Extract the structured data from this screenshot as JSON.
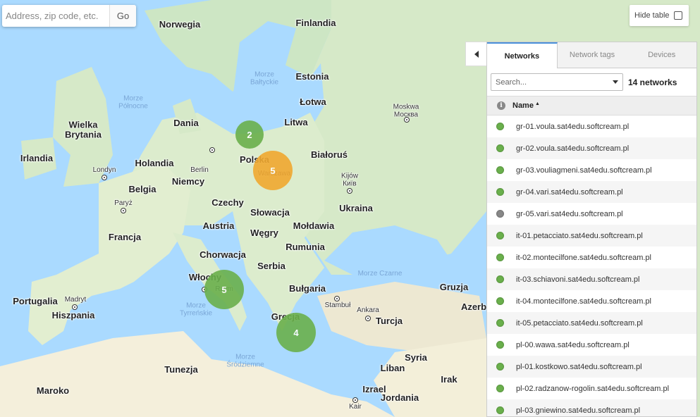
{
  "search": {
    "placeholder": "Address, zip code, etc.",
    "go_label": "Go"
  },
  "hide_table": {
    "label": "Hide table",
    "checked": false
  },
  "panel": {
    "tabs": [
      {
        "label": "Networks",
        "active": true
      },
      {
        "label": "Network tags",
        "active": false
      },
      {
        "label": "Devices",
        "active": false
      }
    ],
    "filter_placeholder": "Search...",
    "count_label": "14 networks",
    "column_info_icon": "i",
    "column_name": "Name",
    "sort_indicator": "▲",
    "status_colors": {
      "online": "#6ab04c",
      "offline": "#888888"
    },
    "rows": [
      {
        "name": "gr-01.voula.sat4edu.softcream.pl",
        "status": "online"
      },
      {
        "name": "gr-02.voula.sat4edu.softcream.pl",
        "status": "online"
      },
      {
        "name": "gr-03.vouliagmeni.sat4edu.softcream.pl",
        "status": "online"
      },
      {
        "name": "gr-04.vari.sat4edu.softcream.pl",
        "status": "online"
      },
      {
        "name": "gr-05.vari.sat4edu.softcream.pl",
        "status": "offline"
      },
      {
        "name": "it-01.petacciato.sat4edu.softcream.pl",
        "status": "online"
      },
      {
        "name": "it-02.montecilfone.sat4edu.softcream.pl",
        "status": "online"
      },
      {
        "name": "it-03.schiavoni.sat4edu.softcream.pl",
        "status": "online"
      },
      {
        "name": "it-04.montecilfone.sat4edu.softcream.pl",
        "status": "online"
      },
      {
        "name": "it-05.petacciato.sat4edu.softcream.pl",
        "status": "online"
      },
      {
        "name": "pl-00.wawa.sat4edu.softcream.pl",
        "status": "online"
      },
      {
        "name": "pl-01.kostkowo.sat4edu.softcream.pl",
        "status": "online"
      },
      {
        "name": "pl-02.radzanow-rogolin.sat4edu.softcream.pl",
        "status": "online"
      },
      {
        "name": "pl-03.gniewino.sat4edu.softcream.pl",
        "status": "online"
      }
    ]
  },
  "map": {
    "clusters": [
      {
        "id": "north-poland",
        "count": "2",
        "color": "#6ab04c"
      },
      {
        "id": "warsaw",
        "count": "5",
        "color": "#f0a830"
      },
      {
        "id": "italy",
        "count": "5",
        "color": "#6ab04c"
      },
      {
        "id": "greece",
        "count": "4",
        "color": "#6ab04c"
      }
    ],
    "countries": [
      "Norwegia",
      "Finlandia",
      "Estonia",
      "Łotwa",
      "Litwa",
      "Dania",
      "Wielka\nBrytania",
      "Irlandia",
      "Holandia",
      "Polska",
      "Białoruś",
      "Niemcy",
      "Belgia",
      "Czechy",
      "Ukraina",
      "Słowacja",
      "Francja",
      "Austria",
      "Węgry",
      "Mołdawia",
      "Rumunia",
      "Chorwacja",
      "Serbia",
      "Włochy",
      "Bułgaria",
      "Portugalia",
      "Hiszpania",
      "Grecja",
      "Turcja",
      "Gruzja",
      "Azerb",
      "Syria",
      "Tunezja",
      "Liban",
      "Irak",
      "Maroko",
      "Izrael",
      "Jordania"
    ],
    "seas": [
      "Morze\nPółnocne",
      "Morze\nBałtyckie",
      "Morze Czarne",
      "Morze\nTyrreńskie",
      "Morze\nŚródziemne"
    ],
    "cities": [
      "Londyn",
      "Berlin",
      "Paryż",
      "Warszawa",
      "Moskwa\nМосква",
      "Kijów\nКиїв",
      "Madryt",
      "Rzym",
      "Stambuł",
      "Ankara",
      "Kair"
    ]
  }
}
